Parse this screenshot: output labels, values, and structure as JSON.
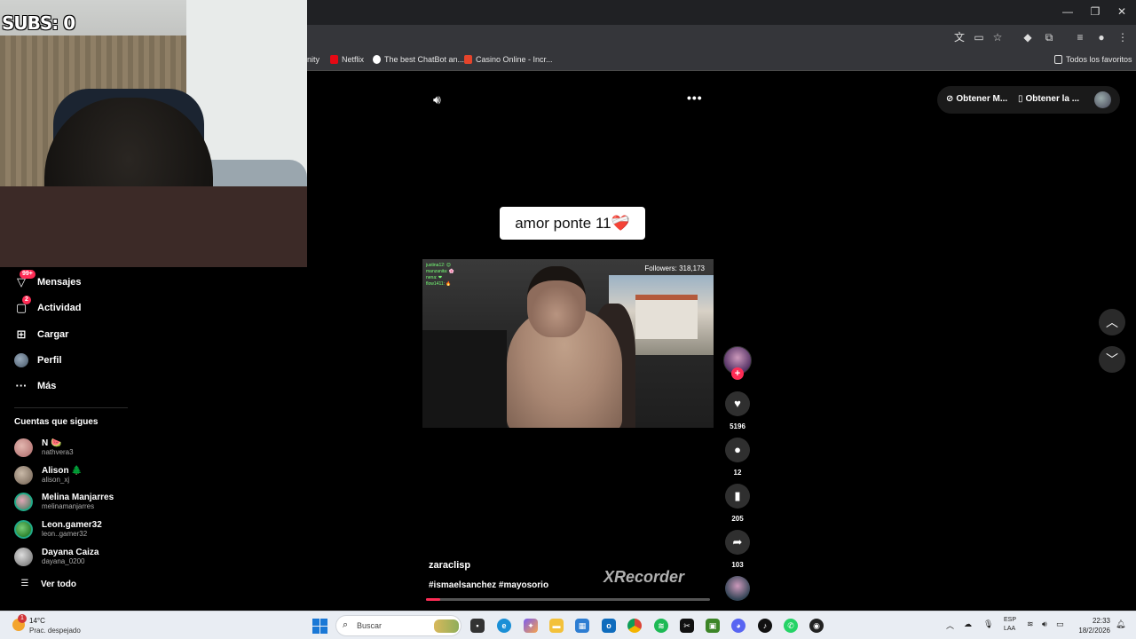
{
  "webcam": {
    "subs_label": "SUBS: 0"
  },
  "browser": {
    "bookmarks": [
      {
        "label": "inity",
        "color": "#35363a"
      },
      {
        "label": "Netflix",
        "color": "#e50914"
      },
      {
        "label": "The best ChatBot an...",
        "color": "#ffffff"
      },
      {
        "label": "Casino Online - Incr...",
        "color": "#e5442b"
      }
    ],
    "all_bookmarks": "Todos los favoritos"
  },
  "sidebar": {
    "items": [
      {
        "label": "Mensajes",
        "icon": "messages-icon",
        "badge": "99+"
      },
      {
        "label": "Actividad",
        "icon": "activity-icon",
        "badge": "2"
      },
      {
        "label": "Cargar",
        "icon": "upload-icon",
        "badge": ""
      },
      {
        "label": "Perfil",
        "icon": "profile-icon",
        "badge": ""
      },
      {
        "label": "Más",
        "icon": "more-icon",
        "badge": ""
      }
    ],
    "following_title": "Cuentas que sigues",
    "following": [
      {
        "name": "N 🍉",
        "user": "nathvera3",
        "color": "#b77"
      },
      {
        "name": "Alison 🌲",
        "user": "alison_xj",
        "color": "#8a7b6d"
      },
      {
        "name": "Melina Manjarres",
        "user": "melinamanjarres",
        "color": "#a36"
      },
      {
        "name": "Leon.gamer32",
        "user": "leon..gamer32",
        "color": "#2a2"
      },
      {
        "name": "Dayana Caiza",
        "user": "dayana_0200",
        "color": "#777"
      }
    ],
    "see_all": "Ver todo"
  },
  "header": {
    "get_m": "Obtener M...",
    "get_app": "Obtener la ..."
  },
  "video": {
    "caption": "amor ponte 11",
    "caption_emoji": "❤️‍🩹",
    "followers": "Followers: 318,173",
    "author": "zaraclisp",
    "tags": "#ismaelsanchez #mayosorio",
    "watermark": "XRecorder",
    "progress": 0.05,
    "chat_lines": [
      "justina12: 😊",
      "manzanita: 🌸",
      "nena: ❤",
      "flow1411: 🔥"
    ]
  },
  "actions": {
    "likes": "5196",
    "comments": "12",
    "saves": "205",
    "shares": "103"
  },
  "taskbar": {
    "temp": "14°C",
    "weather": "Prac. despejado",
    "weather_badge": "1",
    "search_placeholder": "Buscar",
    "lang_1": "ESP",
    "lang_2": "LAA",
    "time": "22:33",
    "date": "18/2/2026"
  }
}
